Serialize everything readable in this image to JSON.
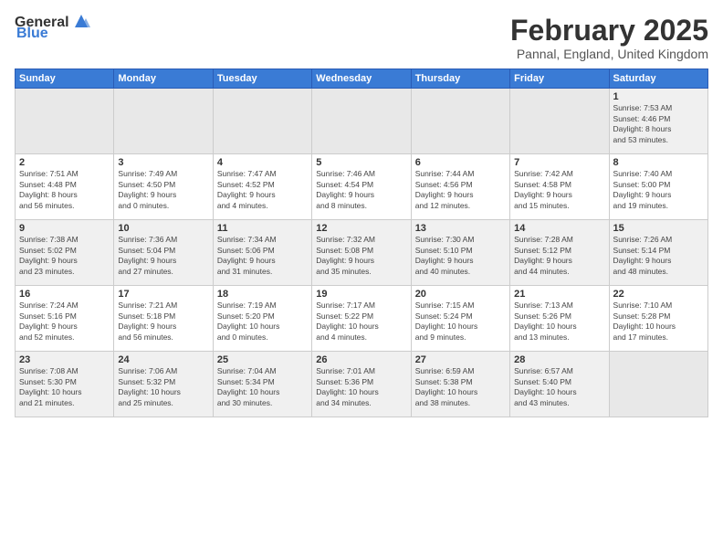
{
  "logo": {
    "general": "General",
    "blue": "Blue"
  },
  "title": "February 2025",
  "subtitle": "Pannal, England, United Kingdom",
  "weekdays": [
    "Sunday",
    "Monday",
    "Tuesday",
    "Wednesday",
    "Thursday",
    "Friday",
    "Saturday"
  ],
  "weeks": [
    [
      {
        "day": "",
        "info": ""
      },
      {
        "day": "",
        "info": ""
      },
      {
        "day": "",
        "info": ""
      },
      {
        "day": "",
        "info": ""
      },
      {
        "day": "",
        "info": ""
      },
      {
        "day": "",
        "info": ""
      },
      {
        "day": "1",
        "info": "Sunrise: 7:53 AM\nSunset: 4:46 PM\nDaylight: 8 hours\nand 53 minutes."
      }
    ],
    [
      {
        "day": "2",
        "info": "Sunrise: 7:51 AM\nSunset: 4:48 PM\nDaylight: 8 hours\nand 56 minutes."
      },
      {
        "day": "3",
        "info": "Sunrise: 7:49 AM\nSunset: 4:50 PM\nDaylight: 9 hours\nand 0 minutes."
      },
      {
        "day": "4",
        "info": "Sunrise: 7:47 AM\nSunset: 4:52 PM\nDaylight: 9 hours\nand 4 minutes."
      },
      {
        "day": "5",
        "info": "Sunrise: 7:46 AM\nSunset: 4:54 PM\nDaylight: 9 hours\nand 8 minutes."
      },
      {
        "day": "6",
        "info": "Sunrise: 7:44 AM\nSunset: 4:56 PM\nDaylight: 9 hours\nand 12 minutes."
      },
      {
        "day": "7",
        "info": "Sunrise: 7:42 AM\nSunset: 4:58 PM\nDaylight: 9 hours\nand 15 minutes."
      },
      {
        "day": "8",
        "info": "Sunrise: 7:40 AM\nSunset: 5:00 PM\nDaylight: 9 hours\nand 19 minutes."
      }
    ],
    [
      {
        "day": "9",
        "info": "Sunrise: 7:38 AM\nSunset: 5:02 PM\nDaylight: 9 hours\nand 23 minutes."
      },
      {
        "day": "10",
        "info": "Sunrise: 7:36 AM\nSunset: 5:04 PM\nDaylight: 9 hours\nand 27 minutes."
      },
      {
        "day": "11",
        "info": "Sunrise: 7:34 AM\nSunset: 5:06 PM\nDaylight: 9 hours\nand 31 minutes."
      },
      {
        "day": "12",
        "info": "Sunrise: 7:32 AM\nSunset: 5:08 PM\nDaylight: 9 hours\nand 35 minutes."
      },
      {
        "day": "13",
        "info": "Sunrise: 7:30 AM\nSunset: 5:10 PM\nDaylight: 9 hours\nand 40 minutes."
      },
      {
        "day": "14",
        "info": "Sunrise: 7:28 AM\nSunset: 5:12 PM\nDaylight: 9 hours\nand 44 minutes."
      },
      {
        "day": "15",
        "info": "Sunrise: 7:26 AM\nSunset: 5:14 PM\nDaylight: 9 hours\nand 48 minutes."
      }
    ],
    [
      {
        "day": "16",
        "info": "Sunrise: 7:24 AM\nSunset: 5:16 PM\nDaylight: 9 hours\nand 52 minutes."
      },
      {
        "day": "17",
        "info": "Sunrise: 7:21 AM\nSunset: 5:18 PM\nDaylight: 9 hours\nand 56 minutes."
      },
      {
        "day": "18",
        "info": "Sunrise: 7:19 AM\nSunset: 5:20 PM\nDaylight: 10 hours\nand 0 minutes."
      },
      {
        "day": "19",
        "info": "Sunrise: 7:17 AM\nSunset: 5:22 PM\nDaylight: 10 hours\nand 4 minutes."
      },
      {
        "day": "20",
        "info": "Sunrise: 7:15 AM\nSunset: 5:24 PM\nDaylight: 10 hours\nand 9 minutes."
      },
      {
        "day": "21",
        "info": "Sunrise: 7:13 AM\nSunset: 5:26 PM\nDaylight: 10 hours\nand 13 minutes."
      },
      {
        "day": "22",
        "info": "Sunrise: 7:10 AM\nSunset: 5:28 PM\nDaylight: 10 hours\nand 17 minutes."
      }
    ],
    [
      {
        "day": "23",
        "info": "Sunrise: 7:08 AM\nSunset: 5:30 PM\nDaylight: 10 hours\nand 21 minutes."
      },
      {
        "day": "24",
        "info": "Sunrise: 7:06 AM\nSunset: 5:32 PM\nDaylight: 10 hours\nand 25 minutes."
      },
      {
        "day": "25",
        "info": "Sunrise: 7:04 AM\nSunset: 5:34 PM\nDaylight: 10 hours\nand 30 minutes."
      },
      {
        "day": "26",
        "info": "Sunrise: 7:01 AM\nSunset: 5:36 PM\nDaylight: 10 hours\nand 34 minutes."
      },
      {
        "day": "27",
        "info": "Sunrise: 6:59 AM\nSunset: 5:38 PM\nDaylight: 10 hours\nand 38 minutes."
      },
      {
        "day": "28",
        "info": "Sunrise: 6:57 AM\nSunset: 5:40 PM\nDaylight: 10 hours\nand 43 minutes."
      },
      {
        "day": "",
        "info": ""
      }
    ]
  ]
}
